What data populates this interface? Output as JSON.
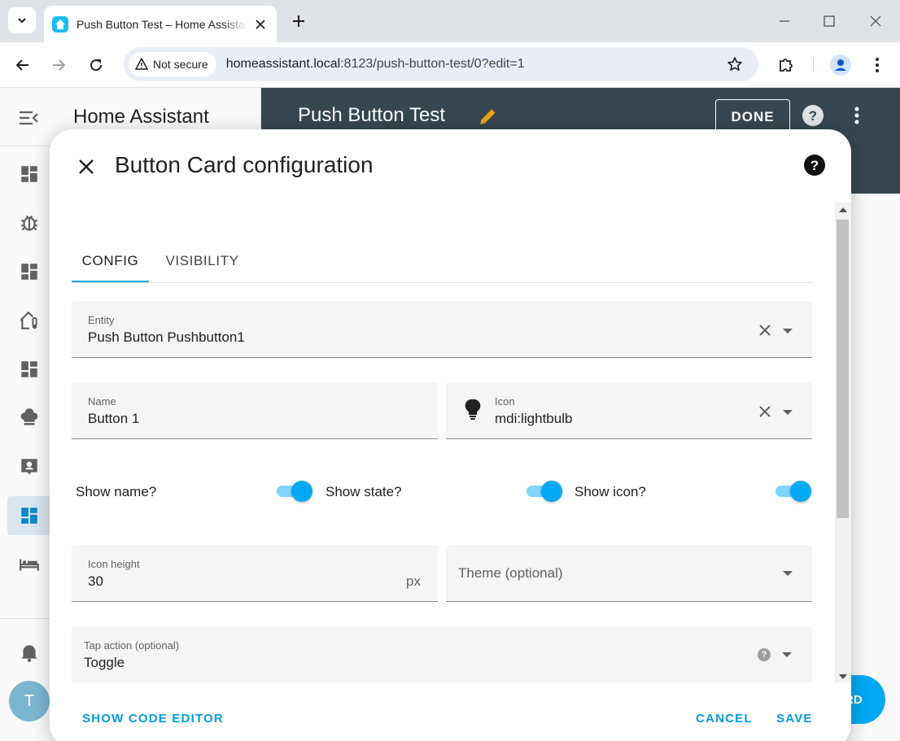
{
  "browser": {
    "tab_title": "Push Button Test – Home Assistant",
    "security_label": "Not secure",
    "url_host": "homeassistant.local",
    "url_path": ":8123/push-button-test/0?edit=1"
  },
  "ha": {
    "app_title": "Home Assistant",
    "page_title": "Push Button Test",
    "done_label": "DONE",
    "avatar_initial": "T",
    "fab_label": "RD",
    "nav_icons": [
      "dashboard-icon",
      "bug-icon",
      "dashboard-icon",
      "home-thermometer-icon",
      "dashboard-icon",
      "chef-hat-icon",
      "account-box-icon",
      "dashboard-icon",
      "bed-icon"
    ]
  },
  "dialog": {
    "title": "Button Card configuration",
    "tabs": [
      {
        "label": "CONFIG",
        "active": true
      },
      {
        "label": "VISIBILITY",
        "active": false
      }
    ],
    "entity": {
      "label": "Entity",
      "value": "Push Button Pushbutton1"
    },
    "name": {
      "label": "Name",
      "value": "Button 1"
    },
    "icon": {
      "label": "Icon",
      "value": "mdi:lightbulb"
    },
    "toggles": [
      {
        "label": "Show name?",
        "on": true
      },
      {
        "label": "Show state?",
        "on": true
      },
      {
        "label": "Show icon?",
        "on": true
      }
    ],
    "icon_height": {
      "label": "Icon height",
      "value": "30",
      "suffix": "px"
    },
    "theme": {
      "placeholder": "Theme (optional)"
    },
    "tap_action": {
      "label": "Tap action (optional)",
      "value": "Toggle"
    },
    "show_code_editor": "SHOW CODE EDITOR",
    "cancel": "CANCEL",
    "save": "SAVE"
  },
  "colors": {
    "accent": "#03a9f4",
    "appbar": "#37474f",
    "pencil": "#e8a317"
  }
}
